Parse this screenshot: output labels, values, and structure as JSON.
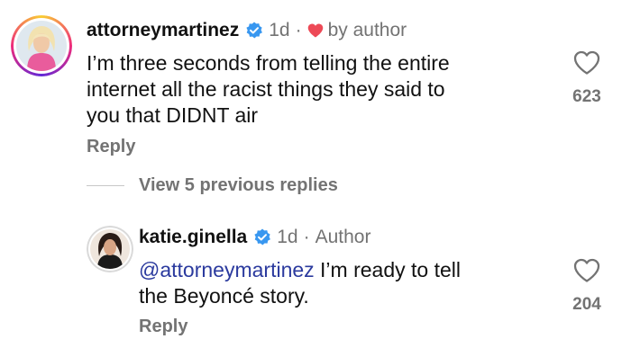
{
  "colors": {
    "text": "#111111",
    "secondary": "#737373",
    "verified": "#3897f0",
    "heart": "#ed4956",
    "mention": "#2b3a9e"
  },
  "comments": [
    {
      "username": "attorneymartinez",
      "verified": true,
      "time": "1d",
      "separator": "·",
      "meta": "by author",
      "meta_icon": "heart-icon",
      "text_lines": [
        "I’m three seconds from telling the entire",
        "internet all the racist things they said to",
        "you that DIDNT air"
      ],
      "reply_label": "Reply",
      "like_count": "623"
    }
  ],
  "view_replies_label": "View 5 previous replies",
  "reply": {
    "username": "katie.ginella",
    "verified": true,
    "time": "1d",
    "separator": "·",
    "meta": "Author",
    "mention": "@attorneymartinez",
    "text_first_line_rest": " I’m ready to tell",
    "text_second_line": "the Beyoncé story.",
    "reply_label": "Reply",
    "like_count": "204"
  }
}
